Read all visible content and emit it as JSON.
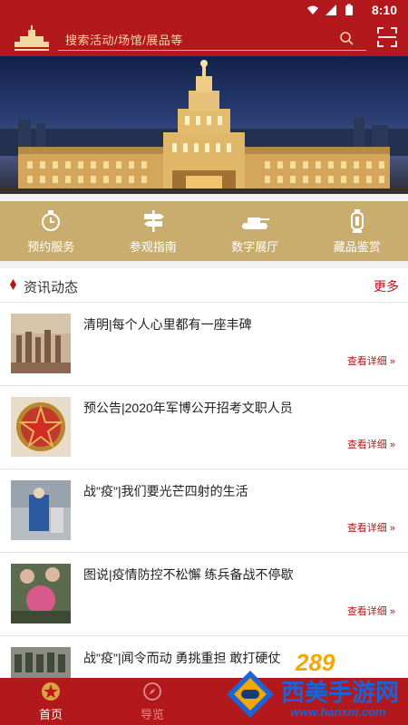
{
  "status_bar": {
    "time": "8:10"
  },
  "header": {
    "search_placeholder": "搜索活动/场馆/展品等"
  },
  "services": [
    {
      "label": "预约服务",
      "icon": "clock-badge-icon"
    },
    {
      "label": "参观指南",
      "icon": "signpost-icon"
    },
    {
      "label": "数字展厅",
      "icon": "tank-icon"
    },
    {
      "label": "藏品鉴赏",
      "icon": "lantern-icon"
    }
  ],
  "news": {
    "title": "资讯动态",
    "more": "更多",
    "detail_label": "查看详细 »",
    "items": [
      {
        "title": "清明|每个人心里都有一座丰碑"
      },
      {
        "title": "预公告|2020年军博公开招考文职人员"
      },
      {
        "title": "战\"疫\"|我们要光芒四射的生活"
      },
      {
        "title": "图说|疫情防控不松懈 练兵备战不停歇"
      },
      {
        "title": "战\"疫\"|闻令而动 勇挑重担 敢打硬仗"
      }
    ]
  },
  "tabbar": [
    {
      "label": "首页",
      "icon": "star-emblem-icon"
    },
    {
      "label": "导览",
      "icon": "compass-icon"
    }
  ],
  "watermark": {
    "number": "289",
    "text": "西美手游网",
    "url": "www.hanxm.com"
  },
  "colors": {
    "primary": "#b3181c",
    "gold": "#c9ad6e",
    "link": "#b3181c"
  }
}
